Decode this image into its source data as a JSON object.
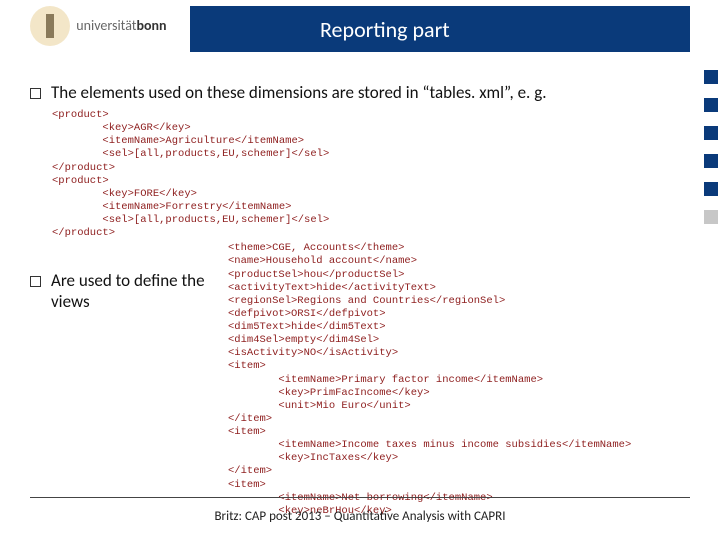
{
  "logo": {
    "part1": "universität",
    "part2": "bonn"
  },
  "header": {
    "title": "Reporting part"
  },
  "bullets": {
    "b1": "The elements used on these dimensions are stored in “tables. xml”, e. g.",
    "b2": "Are used to define the views"
  },
  "code1": {
    "l1": "<product>",
    "l2": "        <key>AGR</key>",
    "l3": "        <itemName>Agriculture</itemName>",
    "l4": "        <sel>[all,products,EU,schemer]</sel>",
    "l5": "</product>",
    "l6": "<product>",
    "l7": "        <key>FORE</key>",
    "l8": "        <itemName>Forrestry</itemName>",
    "l9": "        <sel>[all,products,EU,schemer]</sel>",
    "l10": "</product>"
  },
  "code2": {
    "l1": "<theme>CGE, Accounts</theme>",
    "l2": "<name>Household account</name>",
    "l3": "<productSel>hou</productSel>",
    "l4": "<activityText>hide</activityText>",
    "l5": "<regionSel>Regions and Countries</regionSel>",
    "l6": "<defpivot>ORSI</defpivot>",
    "l7": "<dim5Text>hide</dim5Text>",
    "l8": "<dim4Sel>empty</dim4Sel>",
    "l9": "<isActivity>NO</isActivity>",
    "l10": "<item>",
    "l11": "        <itemName>Primary factor income</itemName>",
    "l12": "        <key>PrimFacIncome</key>",
    "l13": "        <unit>Mio Euro</unit>",
    "l14": "</item>",
    "l15": "<item>",
    "l16": "        <itemName>Income taxes minus income subsidies</itemName>",
    "l17": "        <key>IncTaxes</key>",
    "l18": "</item>",
    "l19": "<item>",
    "l20": "        <itemName>Net borrowing</itemName>",
    "l21": "        <key>neBrHou</key>"
  },
  "footer": "Britz: CAP post 2013 – Quantitative Analysis with CAPRI"
}
